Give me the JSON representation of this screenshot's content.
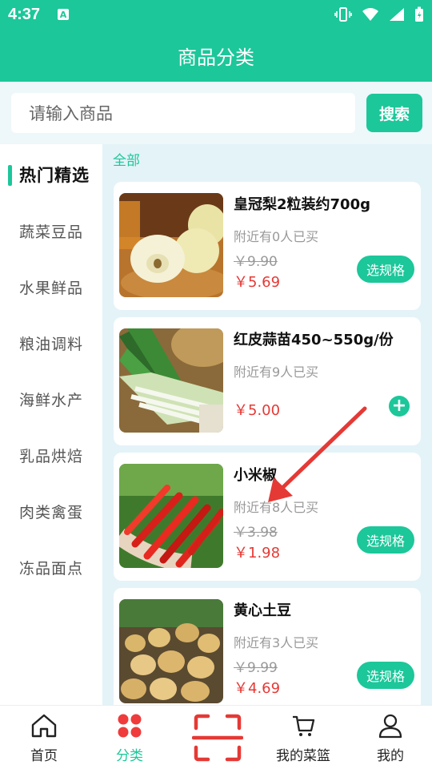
{
  "status": {
    "time": "4:37",
    "app_badge": "A"
  },
  "header": {
    "title": "商品分类"
  },
  "search": {
    "placeholder": "请输入商品",
    "button": "搜索"
  },
  "sidebar": {
    "items": [
      "热门精选",
      "蔬菜豆品",
      "水果鲜品",
      "粮油调料",
      "海鲜水产",
      "乳品烘焙",
      "肉类禽蛋",
      "冻品面点"
    ],
    "active_index": 0
  },
  "content": {
    "section_label": "全部",
    "products": [
      {
        "name": "皇冠梨2粒装约700g",
        "buyers": "附近有0人已买",
        "original_price": "￥9.90",
        "price": "￥5.69",
        "action": "选规格",
        "image": "pear-photo"
      },
      {
        "name": "红皮蒜苗450~550g/份",
        "buyers": "附近有9人已买",
        "original_price": "",
        "price": "￥5.00",
        "action": "+",
        "image": "garlic-sprout-photo"
      },
      {
        "name": "小米椒",
        "buyers": "附近有8人已买",
        "original_price": "￥3.98",
        "price": "￥1.98",
        "action": "选规格",
        "image": "chili-photo"
      },
      {
        "name": "黄心土豆",
        "buyers": "附近有3人已买",
        "original_price": "￥9.99",
        "price": "￥4.69",
        "action": "选规格",
        "image": "potato-photo"
      }
    ]
  },
  "tabbar": {
    "items": [
      "首页",
      "分类",
      "",
      "我的菜篮",
      "我的"
    ],
    "active_index": 1
  },
  "colors": {
    "accent": "#1cc79a",
    "price": "#e53935",
    "annotation_arrow": "#e53935"
  }
}
